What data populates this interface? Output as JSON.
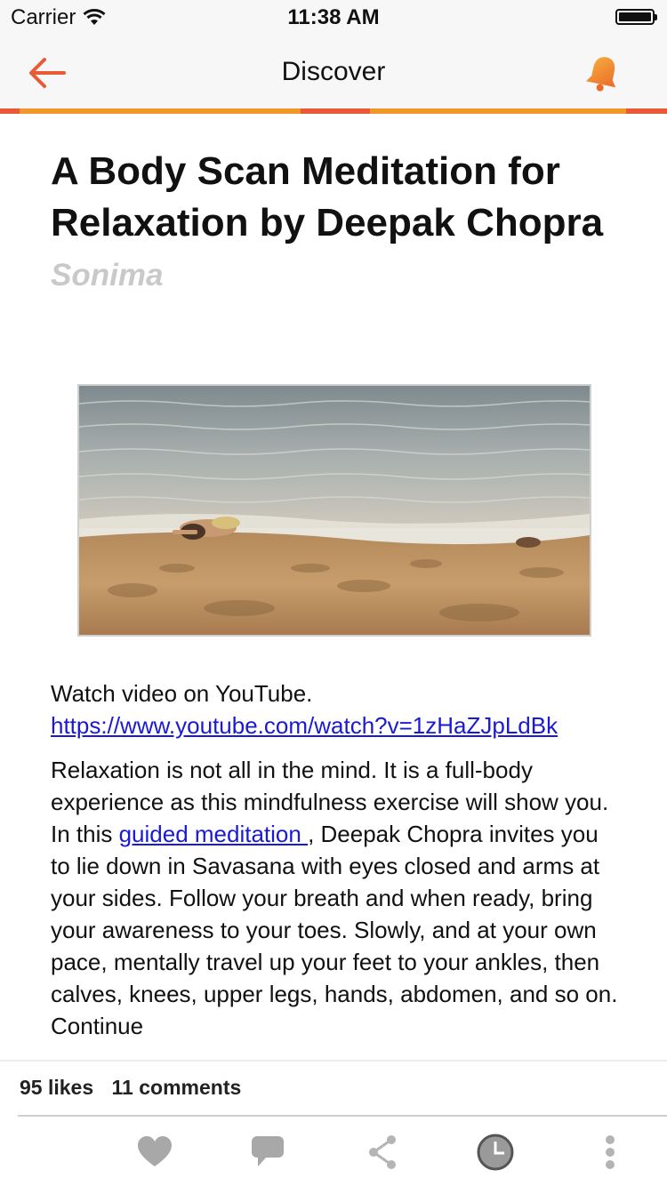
{
  "status_bar": {
    "carrier": "Carrier",
    "time": "11:38 AM"
  },
  "nav": {
    "title": "Discover"
  },
  "article": {
    "title": "A Body Scan Meditation for Relaxation by Deepak Chopra",
    "source": "Sonima",
    "watch_label": "Watch video on YouTube.",
    "youtube_url": "https://www.youtube.com/watch?v=1zHaZJpLdBk",
    "para_part1": "Relaxation is not all in the mind. It is a full-body experience as this mindfulness exercise will show you. In this ",
    "para_link": "guided meditation ",
    "para_part2": ", Deepak Chopra invites you to lie down in Savasana with eyes closed and arms at your sides. Follow your breath and when ready, bring your awareness to your toes. Slowly, and at your own pace, mentally travel up your feet to your ankles, then calves, knees, upper legs, hands, abdomen, and so on. Continue"
  },
  "footer": {
    "likes": "95 likes",
    "comments": "11 comments"
  },
  "colors": {
    "accent_orange": "#f0962a",
    "accent_red": "#e85a37",
    "link_blue": "#1a1ad6",
    "icon_gray": "#a8a8a8"
  }
}
